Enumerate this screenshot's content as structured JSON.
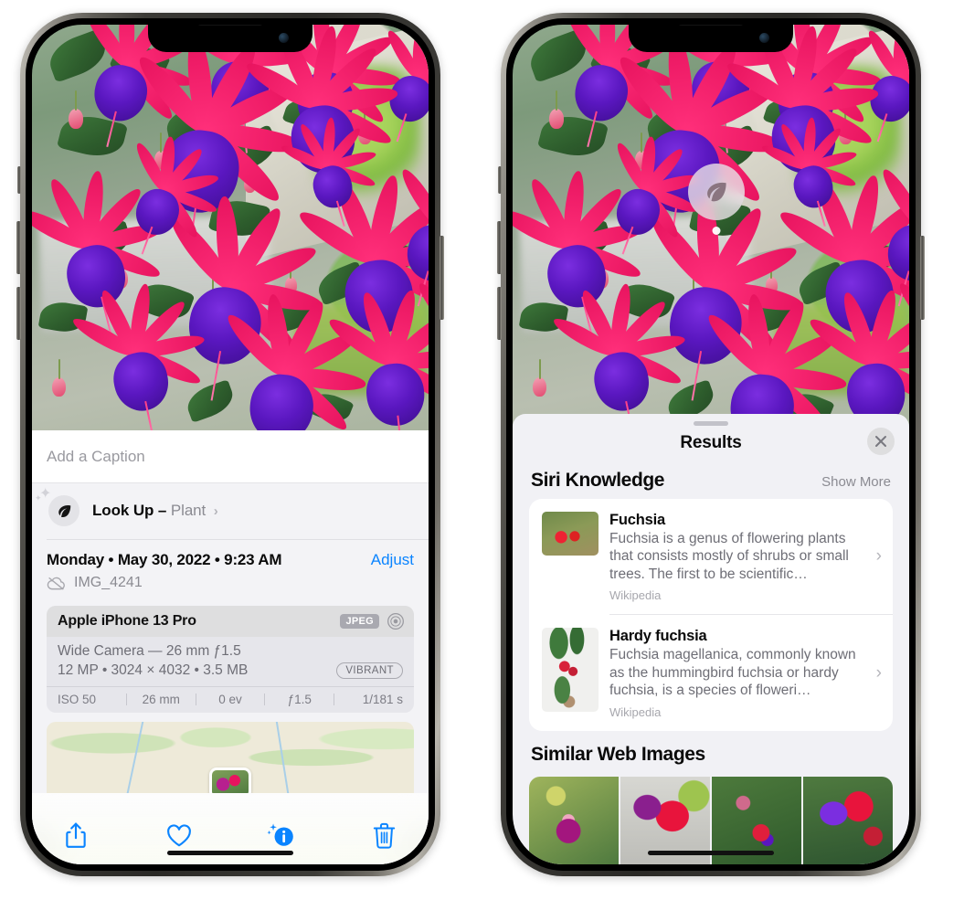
{
  "left_phone": {
    "caption": {
      "placeholder": "Add a Caption",
      "value": ""
    },
    "lookup": {
      "title": "Look Up",
      "dash": "–",
      "subject": "Plant",
      "chevron": "›",
      "icon": "leaf-icon"
    },
    "meta": {
      "date_line": "Monday • May 30, 2022 • 9:23 AM",
      "adjust_label": "Adjust",
      "filename": "IMG_4241",
      "cloud_icon": "cloud-slash-icon"
    },
    "camera_card": {
      "model": "Apple iPhone 13 Pro",
      "format_badge": "JPEG",
      "aperture_icon": "aperture-icon",
      "lens": "Wide Camera — 26 mm ƒ1.5",
      "resolution": "12 MP • 3024 × 4032 • 3.5 MB",
      "style_badge": "VIBRANT",
      "exif": [
        "ISO 50",
        "26 mm",
        "0 ev",
        "ƒ1.5",
        "1/181 s"
      ]
    },
    "toolbar": [
      {
        "name": "share-icon",
        "label": "Share"
      },
      {
        "name": "heart-icon",
        "label": "Favorite"
      },
      {
        "name": "info-sparkle-icon",
        "label": "Info"
      },
      {
        "name": "trash-icon",
        "label": "Delete"
      }
    ]
  },
  "right_phone": {
    "badge": {
      "icon": "leaf-icon"
    },
    "sheet": {
      "title": "Results",
      "close_icon": "close-icon",
      "grabber": "drag-handle"
    },
    "siri_knowledge": {
      "title": "Siri Knowledge",
      "show_more": "Show More",
      "items": [
        {
          "name": "Fuchsia",
          "description": "Fuchsia is a genus of flowering plants that consists mostly of shrubs or small trees. The first to be scientific…",
          "source": "Wikipedia",
          "chevron": "›"
        },
        {
          "name": "Hardy fuchsia",
          "description": "Fuchsia magellanica, commonly known as the hummingbird fuchsia or hardy fuchsia, is a species of floweri…",
          "source": "Wikipedia",
          "chevron": "›"
        }
      ]
    },
    "similar_web_images": {
      "title": "Similar Web Images",
      "thumbnails": [
        "fuchsia-thumb-1",
        "fuchsia-thumb-2",
        "fuchsia-thumb-3",
        "fuchsia-thumb-4"
      ]
    }
  },
  "colors": {
    "accent_blue": "#0a84ff",
    "sheet_bg": "#f1f1f5",
    "card_bg": "#ffffff",
    "camera_card_bg": "#e6e6eb",
    "secondary_text": "#8b8b92",
    "primary_text": "#0a0a0a"
  }
}
